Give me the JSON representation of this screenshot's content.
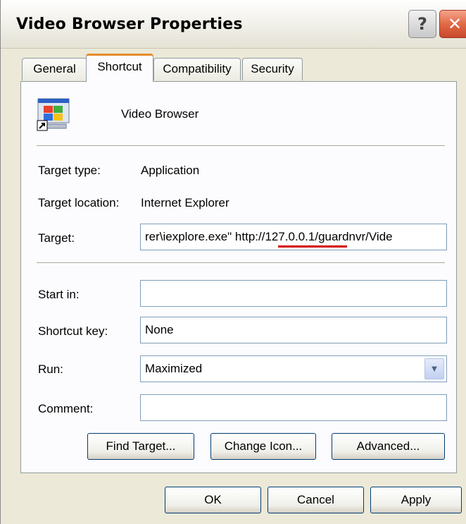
{
  "window": {
    "title": "Video Browser Properties",
    "help_glyph": "?",
    "close_glyph": "✕"
  },
  "tabs": [
    {
      "label": "General",
      "active": false
    },
    {
      "label": "Shortcut",
      "active": true
    },
    {
      "label": "Compatibility",
      "active": false
    },
    {
      "label": "Security",
      "active": false
    }
  ],
  "shortcut": {
    "icon": "internet-explorer-shortcut-icon",
    "name": "Video Browser",
    "target_type_label": "Target type:",
    "target_type_value": "Application",
    "target_location_label": "Target location:",
    "target_location_value": "Internet Explorer",
    "target_label": "Target:",
    "target_value": "rer\\iexplore.exe\" http://127.0.0.1/guardnvr/Vide",
    "start_in_label": "Start in:",
    "start_in_value": "",
    "shortcut_key_label": "Shortcut key:",
    "shortcut_key_value": "None",
    "run_label": "Run:",
    "run_value": "Maximized",
    "comment_label": "Comment:",
    "comment_value": "",
    "find_target_label": "Find Target...",
    "change_icon_label": "Change Icon...",
    "advanced_label": "Advanced..."
  },
  "footer": {
    "ok_label": "OK",
    "cancel_label": "Cancel",
    "apply_label": "Apply"
  },
  "colors": {
    "highlight_underline": "#d40000",
    "active_tab_accent": "#e68b2c",
    "dialog_background": "#ece9d8"
  }
}
